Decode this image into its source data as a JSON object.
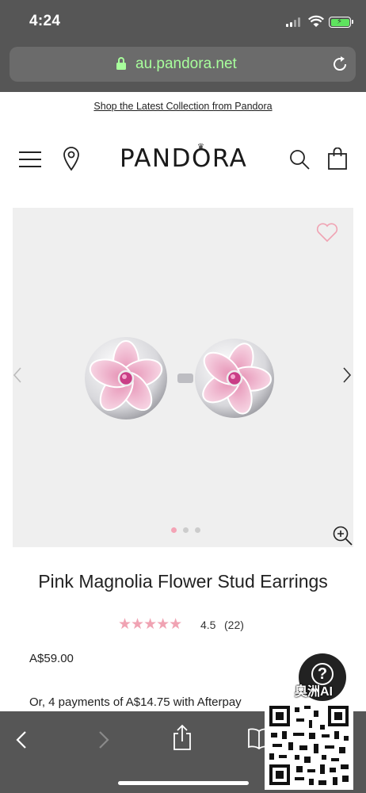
{
  "status_bar": {
    "time": "4:24"
  },
  "browser": {
    "url": "au.pandora.net"
  },
  "promo": {
    "link_text": "Shop the Latest Collection from Pandora"
  },
  "header": {
    "logo_text": "PANDORA"
  },
  "gallery": {
    "image_count": 3,
    "active_index": 0
  },
  "product": {
    "title": "Pink Magnolia Flower Stud Earrings",
    "rating_stars": "★★★★★",
    "rating_value": "4.5",
    "review_count": "(22)",
    "price": "A$59.00",
    "installments": "Or, 4 payments of A$14.75 with Afterpay"
  },
  "help": {
    "glyph": "?"
  },
  "watermark": {
    "text": "奥洲AI"
  },
  "colors": {
    "browser_chrome": "#565656",
    "url_text": "#a8ff9c",
    "accent_pink": "#f0a3b3",
    "gallery_bg": "#efefef"
  }
}
